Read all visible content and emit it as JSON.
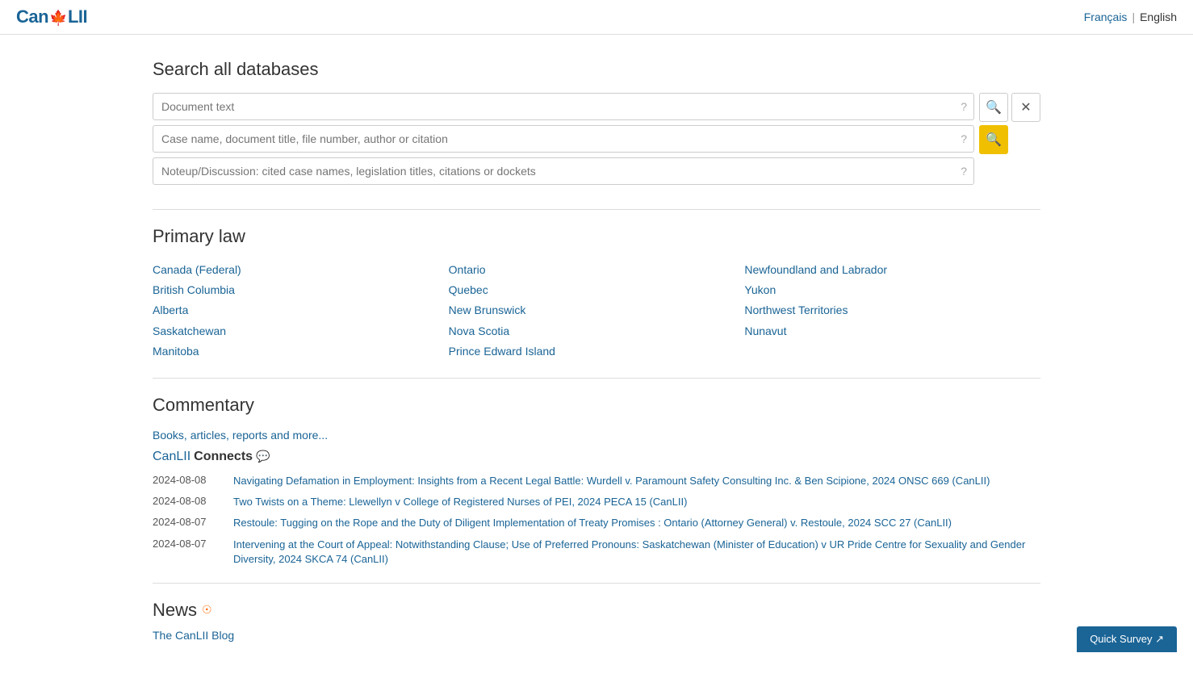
{
  "header": {
    "logo": "CanLII",
    "lang_french": "Français",
    "lang_english": "English"
  },
  "search": {
    "title": "Search all databases",
    "placeholder1": "Document text",
    "placeholder2": "Case name, document title, file number, author or citation",
    "placeholder3": "Noteup/Discussion: cited case names, legislation titles, citations or dockets",
    "help_icon": "?",
    "btn_search_label": "🔍",
    "btn_clear_label": "✕",
    "btn_main_search_label": "🔍"
  },
  "primary_law": {
    "title": "Primary law",
    "provinces": [
      {
        "name": "Canada (Federal)",
        "col": 1
      },
      {
        "name": "British Columbia",
        "col": 1
      },
      {
        "name": "Alberta",
        "col": 1
      },
      {
        "name": "Saskatchewan",
        "col": 1
      },
      {
        "name": "Manitoba",
        "col": 1
      },
      {
        "name": "Ontario",
        "col": 2
      },
      {
        "name": "Quebec",
        "col": 2
      },
      {
        "name": "New Brunswick",
        "col": 2
      },
      {
        "name": "Nova Scotia",
        "col": 2
      },
      {
        "name": "Prince Edward Island",
        "col": 2
      },
      {
        "name": "Newfoundland and Labrador",
        "col": 3
      },
      {
        "name": "Yukon",
        "col": 3
      },
      {
        "name": "Northwest Territories",
        "col": 3
      },
      {
        "name": "Nunavut",
        "col": 3
      }
    ]
  },
  "commentary": {
    "title": "Commentary",
    "books_link": "Books, articles, reports and more...",
    "connects_label_normal": "CanLII",
    "connects_label_bold": "Connects",
    "entries": [
      {
        "date": "2024-08-08",
        "text": "Navigating Defamation in Employment: Insights from a Recent Legal Battle: Wurdell v. Paramount Safety Consulting Inc. & Ben Scipione, 2024 ONSC 669 (CanLII)"
      },
      {
        "date": "2024-08-08",
        "text": "Two Twists on a Theme: Llewellyn v College of Registered Nurses of PEI, 2024 PECA 15 (CanLII)"
      },
      {
        "date": "2024-08-07",
        "text": "Restoule: Tugging on the Rope and the Duty of Diligent Implementation of Treaty Promises : Ontario (Attorney General) v. Restoule, 2024 SCC 27 (CanLII)"
      },
      {
        "date": "2024-08-07",
        "text": "Intervening at the Court of Appeal: Notwithstanding Clause; Use of Preferred Pronouns: Saskatchewan (Minister of Education) v UR Pride Centre for Sexuality and Gender Diversity, 2024 SKCA 74 (CanLII)"
      }
    ]
  },
  "news": {
    "title": "News",
    "blog_link": "The CanLII Blog"
  },
  "quick_survey": {
    "label": "Quick Survey ↗"
  }
}
